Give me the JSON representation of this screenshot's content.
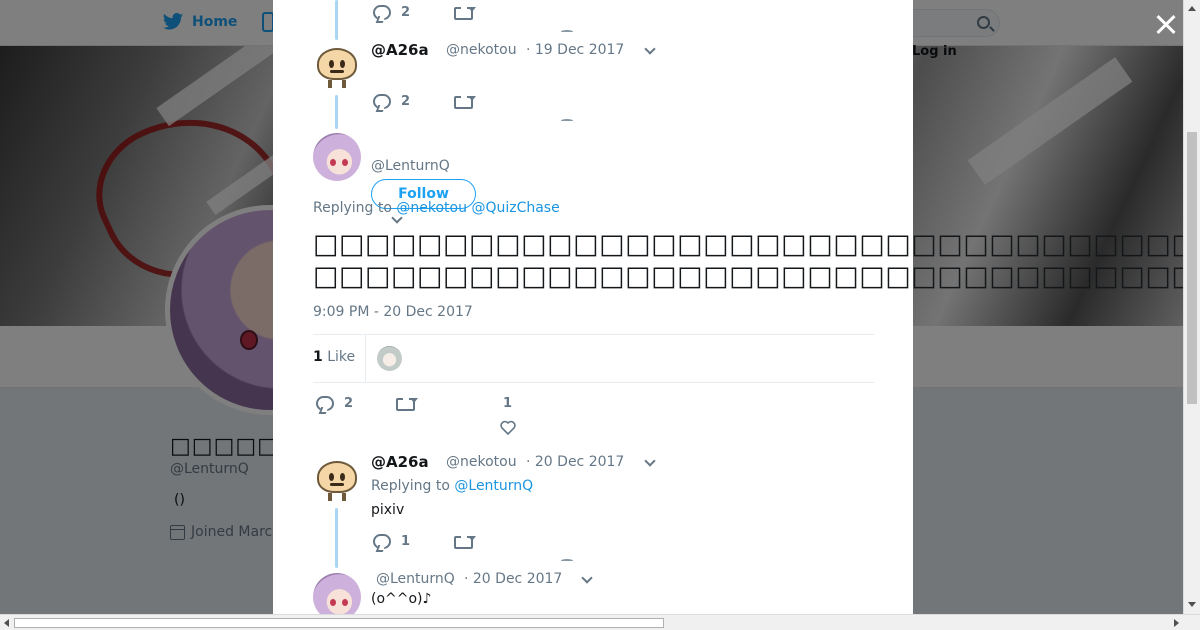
{
  "nav": {
    "home_label": "Home",
    "login_label": "Log in"
  },
  "profile": {
    "name": "□□□□□□",
    "handle": "@LenturnQ",
    "bio": "()",
    "joined": "Joined March"
  },
  "tweets": [
    {
      "reply_count": "2"
    },
    {
      "name": "@A26a",
      "handle": "@nekotou",
      "date": "· 19 Dec 2017",
      "reply_count": "2"
    }
  ],
  "main_tweet": {
    "handle": "@LenturnQ",
    "follow_label": "Follow",
    "replying_prefix": "Replying to",
    "replying_hidden": "@nekotou",
    "replying_mention": "@QuizChase",
    "line1": "□□□□□□□□□□□□□□□□□□□□□□□□□□□□□□□□□□□□□",
    "line2": "□□□□□□□□□□□□□□□□□□□□□□□□□□□□□□□□□□□□□□□□□□□□□□□□□□□□□",
    "timestamp": "9:09 PM - 20 Dec 2017",
    "likes_count": "1",
    "likes_label": "Like",
    "reply_count": "2",
    "like_count": "1"
  },
  "replies": [
    {
      "name": "@A26a",
      "handle": "@nekotou",
      "date": "· 20 Dec 2017",
      "replying_prefix": "Replying to",
      "replying_mention": "@LenturnQ",
      "text": "pixiv",
      "reply_count": "1"
    },
    {
      "handle": "@LenturnQ",
      "date": "· 20 Dec 2017",
      "text": "(o^^o)♪"
    }
  ],
  "icons": [
    "twitter-bird-icon",
    "search-icon",
    "calendar-icon",
    "close-icon",
    "reply-icon",
    "retweet-icon",
    "heart-icon",
    "chevron-down-icon"
  ],
  "colors": {
    "accent": "#1da1f2",
    "link": "#1b95e0",
    "muted": "#657786",
    "thread_line": "#a8d6f5"
  }
}
